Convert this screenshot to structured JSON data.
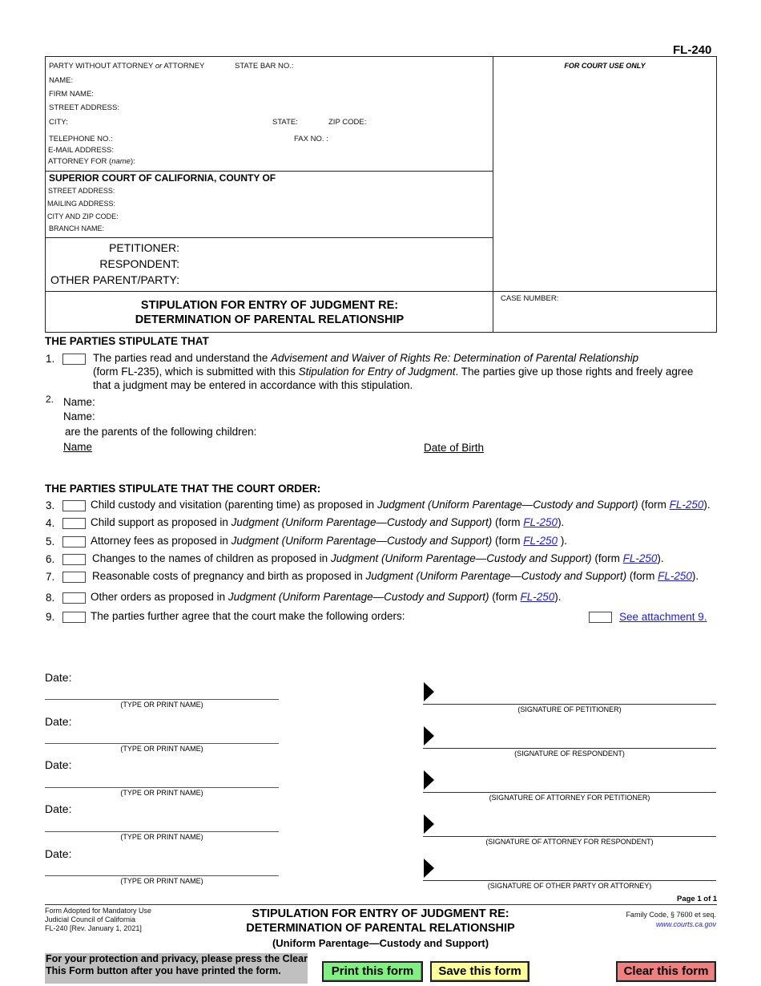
{
  "form_id": "FL-240",
  "header": {
    "attorney": {
      "party_label_pre": "PARTY WITHOUT ATTORNEY ",
      "party_label_or": "or",
      "party_label_post": " ATTORNEY",
      "state_bar": "STATE BAR NO.:",
      "name": "NAME:",
      "firm_name": "FIRM NAME:",
      "street_address": "STREET ADDRESS:",
      "city": "CITY:",
      "state": "STATE:",
      "zip": "ZIP CODE:",
      "telephone": "TELEPHONE NO.:",
      "fax": "FAX NO. :",
      "email": "E-MAIL ADDRESS:",
      "attorney_for_pre": "ATTORNEY FOR (",
      "attorney_for_name": "name",
      "attorney_for_post": "):"
    },
    "court": {
      "title": "SUPERIOR COURT OF CALIFORNIA, COUNTY OF",
      "street_address": "STREET ADDRESS:",
      "mailing_address": "MAILING ADDRESS:",
      "city_zip": "CITY AND ZIP CODE:",
      "branch": "BRANCH NAME:"
    },
    "parties": {
      "petitioner": "PETITIONER:",
      "respondent": "RESPONDENT:",
      "other": "OTHER PARENT/PARTY:"
    },
    "title_line1": "STIPULATION FOR ENTRY OF JUDGMENT RE:",
    "title_line2": "DETERMINATION OF PARENTAL RELATIONSHIP",
    "court_use_only": "FOR COURT USE ONLY",
    "case_number": "CASE NUMBER:"
  },
  "section1": {
    "heading": "THE PARTIES STIPULATE THAT",
    "item1": {
      "num": "1.",
      "checked": false,
      "line1_pre": "The parties read and understand the ",
      "line1_italic": "Advisement and Waiver of Rights Re: Determination of Parental Relationship",
      "line2_pre": "(form FL-235), which is submitted with this ",
      "line2_italic": "Stipulation for Entry of Judgment",
      "line2_post": ". The parties give up those rights and freely agree",
      "line3": "that a judgment may be entered in accordance with this stipulation."
    },
    "item2": {
      "num": "2.",
      "name1": "Name:",
      "name2": "Name:",
      "parents_text": "are the parents of the following children:",
      "col_name": "Name",
      "col_dob": "Date of Birth"
    }
  },
  "section2": {
    "heading": "THE PARTIES STIPULATE THAT THE COURT ORDER:",
    "judgment_italic": "Judgment (Uniform Parentage—Custody and Support)",
    "form_link": "FL-250",
    "items": [
      {
        "num": "3.",
        "checked": false,
        "text": "Child custody and visitation (parenting time) as proposed in ",
        "post_pre": " (form ",
        "post_end": ")."
      },
      {
        "num": "4.",
        "checked": false,
        "text": "Child support as proposed in ",
        "post_pre": " (form ",
        "post_end": ")."
      },
      {
        "num": "5.",
        "checked": false,
        "text": "Attorney fees as proposed in ",
        "post_pre": " (form ",
        "post_end": " )."
      },
      {
        "num": "6.",
        "checked": false,
        "text": "Changes to the names of children as proposed in ",
        "post_pre": " (form ",
        "post_end": ")."
      },
      {
        "num": "7.",
        "checked": false,
        "text": "Reasonable costs of pregnancy and birth as proposed in ",
        "post_pre": " (form ",
        "post_end": ")."
      },
      {
        "num": "8.",
        "checked": false,
        "text": "Other orders as proposed in ",
        "post_pre": " (form ",
        "post_end": ")."
      }
    ],
    "item9": {
      "num": "9.",
      "checked": false,
      "text": "The parties further agree that the court make the following orders:",
      "attachment_checked": false,
      "attachment_link": "See attachment 9."
    }
  },
  "signatures": {
    "date_label": "Date:",
    "name_caption": "(TYPE OR PRINT NAME)",
    "rows": [
      {
        "sig_caption": "(SIGNATURE OF PETITIONER)"
      },
      {
        "sig_caption": "(SIGNATURE OF RESPONDENT)"
      },
      {
        "sig_caption": "(SIGNATURE OF ATTORNEY FOR PETITIONER)"
      },
      {
        "sig_caption": "(SIGNATURE OF ATTORNEY FOR RESPONDENT)"
      },
      {
        "sig_caption": "(SIGNATURE OF OTHER PARTY OR ATTORNEY)"
      }
    ]
  },
  "footer": {
    "page": "Page 1 of 1",
    "adopted_line1": "Form Adopted for Mandatory Use",
    "adopted_line2": "Judicial Council of California",
    "adopted_line3": "FL-240 [Rev. January 1, 2021]",
    "title_line1": "STIPULATION FOR ENTRY OF JUDGMENT RE:",
    "title_line2": "DETERMINATION OF PARENTAL RELATIONSHIP",
    "subtitle": "(Uniform Parentage—Custody and Support)",
    "code": "Family Code, § 7600 et seq.",
    "website": "www.courts.ca.gov"
  },
  "actions": {
    "privacy_line1": "For your protection and privacy, please press the Clear",
    "privacy_line2": "This Form button after you have printed the form.",
    "print_label": "Print this form",
    "save_label": "Save this form",
    "clear_label": "Clear this form",
    "print_color": "#80f080",
    "save_color": "#ffff99",
    "clear_color": "#f08080"
  }
}
